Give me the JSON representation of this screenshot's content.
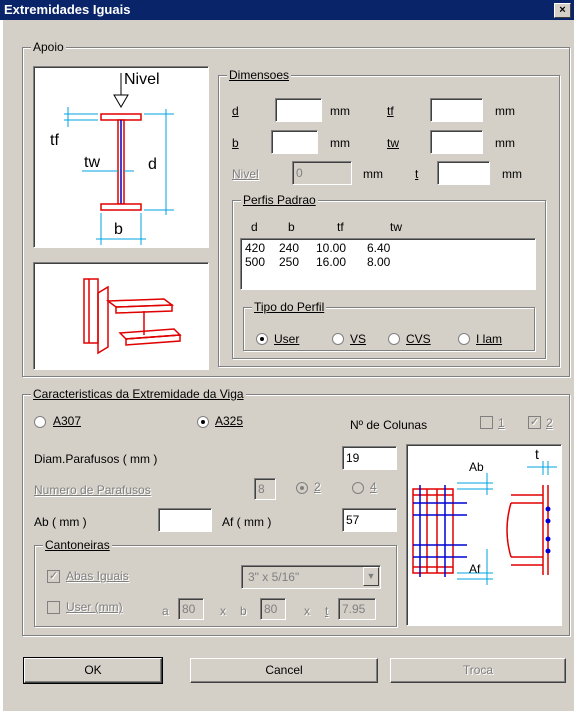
{
  "window": {
    "title": "Extremidades Iguais",
    "close_label": "×"
  },
  "apoio": {
    "legend": "Apoio",
    "diagram_labels": {
      "nivel": "Nivel",
      "tf": "tf",
      "tw": "tw",
      "d": "d",
      "b": "b"
    }
  },
  "dimensoes": {
    "legend": "Dimensoes",
    "d_label": "d",
    "d_value": "",
    "d_unit": "mm",
    "tf_label": "tf",
    "tf_value": "",
    "tf_unit": "mm",
    "b_label": "b",
    "b_value": "",
    "b_unit": "mm",
    "tw_label": "tw",
    "tw_value": "",
    "tw_unit": "mm",
    "nivel_label": "Nivel",
    "nivel_value": "0",
    "nivel_unit": "mm",
    "t_label": "t",
    "t_value": "",
    "t_unit": "mm"
  },
  "perfis": {
    "legend": "Perfis Padrao",
    "headers": [
      "d",
      "b",
      "tf",
      "tw"
    ],
    "rows": [
      [
        "420",
        "240",
        "10.00",
        "6.40"
      ],
      [
        "500",
        "250",
        "16.00",
        "8.00"
      ]
    ]
  },
  "tipo_perfil": {
    "legend": "Tipo do Perfil",
    "options": [
      "User",
      "VS",
      "CVS",
      "I lam"
    ],
    "selected": "User"
  },
  "caracteristicas": {
    "legend": "Caracteristicas da Extremidade da Viga",
    "a307_label": "A307",
    "a325_label": "A325",
    "selected_bolt": "A325",
    "ncolunas_label": "Nº de Colunas",
    "col1_label": "1",
    "col2_label": "2",
    "diam_label": "Diam.Parafusos   ( mm )",
    "diam_value": "19",
    "numero_label": "Numero de Parafusos",
    "numero_value": "8",
    "num_opt2": "2",
    "num_opt4": "4",
    "ab_label": "Ab ( mm )",
    "ab_value": "",
    "af_label": "Af ( mm )",
    "af_value": "57",
    "detail_labels": {
      "ab": "Ab",
      "af": "Af",
      "t": "t"
    }
  },
  "cantoneiras": {
    "legend": "Cantoneiras",
    "abas_label": "Abas Iguais",
    "abas_checked": true,
    "size_value": "3\" x 5/16\"",
    "user_label": "User (mm)",
    "user_checked": false,
    "a_label": "a",
    "a_value": "80",
    "x1": "x",
    "b_label": "b",
    "b_value": "80",
    "x2": "x",
    "t_label": "t",
    "t_value": "7.95"
  },
  "buttons": {
    "ok": "OK",
    "cancel": "Cancel",
    "troca": "Troca"
  }
}
